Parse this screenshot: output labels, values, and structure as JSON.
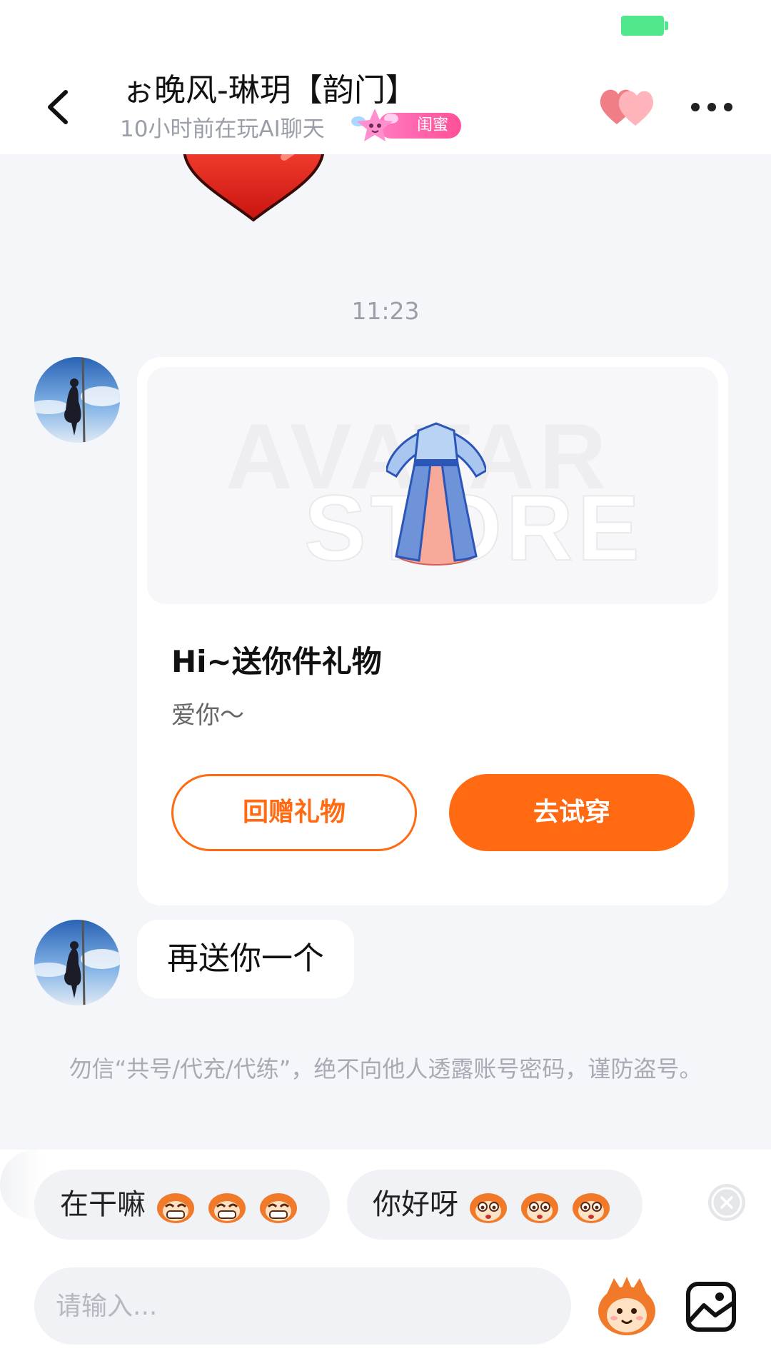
{
  "header": {
    "title": "ぉ晚风-琳玥【韵门】",
    "subtitle": "10小时前在玩AI聊天",
    "relationship_badge": "闺蜜"
  },
  "chat": {
    "timestamp": "11:23",
    "gift_card": {
      "watermark_line1": "AVATAR",
      "watermark_line2": "STORE",
      "title": "Hi~送你件礼物",
      "message": "爱你～",
      "return_gift_label": "回赠礼物",
      "try_on_label": "去试穿"
    },
    "text_message": "再送你一个",
    "safety_notice": "勿信“共号/代充/代练”，绝不向他人透露账号密码，谨防盗号。"
  },
  "quick_replies": [
    {
      "label": "在干嘛",
      "emoji_icon": "grinning-monkey-icon"
    },
    {
      "label": "你好呀",
      "emoji_icon": "wide-eyed-monkey-icon"
    }
  ],
  "composer": {
    "placeholder": "请输入..."
  },
  "colors": {
    "accent": "#ff6a12",
    "badge": "#ff5097",
    "battery": "#4fe68c",
    "background": "#f4f6fa"
  }
}
